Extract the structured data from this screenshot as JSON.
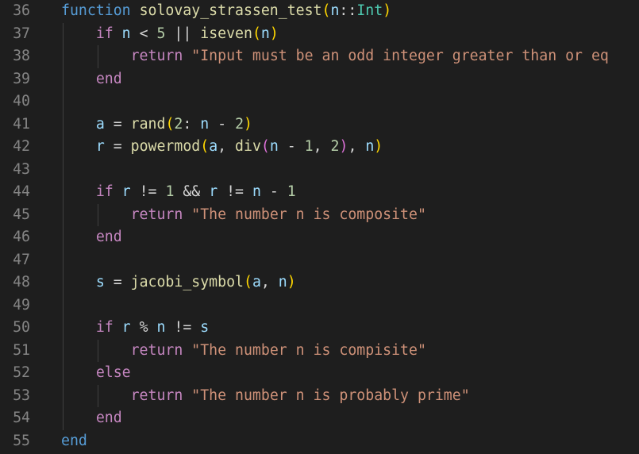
{
  "editor": {
    "theme": {
      "background": "#1e1e1e",
      "line_number": "#858585",
      "keyword": "#569cd6",
      "control": "#c586c0",
      "function": "#dcdcaa",
      "variable": "#9cdcfe",
      "type": "#4ec9b0",
      "number": "#b5cea8",
      "string": "#ce9178",
      "bracket_1": "#ffd700",
      "bracket_2": "#da70d6",
      "bracket_3": "#179fff"
    },
    "lines": [
      {
        "num": "36",
        "tokens": [
          {
            "c": "kw",
            "t": "function"
          },
          {
            "c": "op",
            "t": " "
          },
          {
            "c": "fn",
            "t": "solovay_strassen_test"
          },
          {
            "c": "b1",
            "t": "("
          },
          {
            "c": "var",
            "t": "n"
          },
          {
            "c": "op",
            "t": "::"
          },
          {
            "c": "ty",
            "t": "Int"
          },
          {
            "c": "b1",
            "t": ")"
          }
        ]
      },
      {
        "num": "37",
        "tokens": [
          {
            "c": "op",
            "t": "    "
          },
          {
            "c": "ctl",
            "t": "if"
          },
          {
            "c": "op",
            "t": " "
          },
          {
            "c": "var",
            "t": "n"
          },
          {
            "c": "op",
            "t": " < "
          },
          {
            "c": "num",
            "t": "5"
          },
          {
            "c": "op",
            "t": " || "
          },
          {
            "c": "fn",
            "t": "iseven"
          },
          {
            "c": "b1",
            "t": "("
          },
          {
            "c": "var",
            "t": "n"
          },
          {
            "c": "b1",
            "t": ")"
          }
        ]
      },
      {
        "num": "38",
        "tokens": [
          {
            "c": "op",
            "t": "        "
          },
          {
            "c": "ctl",
            "t": "return"
          },
          {
            "c": "op",
            "t": " "
          },
          {
            "c": "str",
            "t": "\"Input must be an odd integer greater than or eq"
          }
        ]
      },
      {
        "num": "39",
        "tokens": [
          {
            "c": "op",
            "t": "    "
          },
          {
            "c": "ctl",
            "t": "end"
          }
        ]
      },
      {
        "num": "40",
        "tokens": []
      },
      {
        "num": "41",
        "tokens": [
          {
            "c": "op",
            "t": "    "
          },
          {
            "c": "var",
            "t": "a"
          },
          {
            "c": "op",
            "t": " = "
          },
          {
            "c": "fn",
            "t": "rand"
          },
          {
            "c": "b1",
            "t": "("
          },
          {
            "c": "num",
            "t": "2"
          },
          {
            "c": "op",
            "t": ": "
          },
          {
            "c": "var",
            "t": "n"
          },
          {
            "c": "op",
            "t": " - "
          },
          {
            "c": "num",
            "t": "2"
          },
          {
            "c": "b1",
            "t": ")"
          }
        ]
      },
      {
        "num": "42",
        "tokens": [
          {
            "c": "op",
            "t": "    "
          },
          {
            "c": "var",
            "t": "r"
          },
          {
            "c": "op",
            "t": " = "
          },
          {
            "c": "fn",
            "t": "powermod"
          },
          {
            "c": "b1",
            "t": "("
          },
          {
            "c": "var",
            "t": "a"
          },
          {
            "c": "op",
            "t": ", "
          },
          {
            "c": "fn",
            "t": "div"
          },
          {
            "c": "b2",
            "t": "("
          },
          {
            "c": "var",
            "t": "n"
          },
          {
            "c": "op",
            "t": " - "
          },
          {
            "c": "num",
            "t": "1"
          },
          {
            "c": "op",
            "t": ", "
          },
          {
            "c": "num",
            "t": "2"
          },
          {
            "c": "b2",
            "t": ")"
          },
          {
            "c": "op",
            "t": ", "
          },
          {
            "c": "var",
            "t": "n"
          },
          {
            "c": "b1",
            "t": ")"
          }
        ]
      },
      {
        "num": "43",
        "tokens": []
      },
      {
        "num": "44",
        "tokens": [
          {
            "c": "op",
            "t": "    "
          },
          {
            "c": "ctl",
            "t": "if"
          },
          {
            "c": "op",
            "t": " "
          },
          {
            "c": "var",
            "t": "r"
          },
          {
            "c": "op",
            "t": " != "
          },
          {
            "c": "num",
            "t": "1"
          },
          {
            "c": "op",
            "t": " && "
          },
          {
            "c": "var",
            "t": "r"
          },
          {
            "c": "op",
            "t": " != "
          },
          {
            "c": "var",
            "t": "n"
          },
          {
            "c": "op",
            "t": " - "
          },
          {
            "c": "num",
            "t": "1"
          }
        ]
      },
      {
        "num": "45",
        "tokens": [
          {
            "c": "op",
            "t": "        "
          },
          {
            "c": "ctl",
            "t": "return"
          },
          {
            "c": "op",
            "t": " "
          },
          {
            "c": "str",
            "t": "\"The number n is composite\""
          }
        ]
      },
      {
        "num": "46",
        "tokens": [
          {
            "c": "op",
            "t": "    "
          },
          {
            "c": "ctl",
            "t": "end"
          }
        ]
      },
      {
        "num": "47",
        "tokens": []
      },
      {
        "num": "48",
        "tokens": [
          {
            "c": "op",
            "t": "    "
          },
          {
            "c": "var",
            "t": "s"
          },
          {
            "c": "op",
            "t": " = "
          },
          {
            "c": "fn",
            "t": "jacobi_symbol"
          },
          {
            "c": "b1",
            "t": "("
          },
          {
            "c": "var",
            "t": "a"
          },
          {
            "c": "op",
            "t": ", "
          },
          {
            "c": "var",
            "t": "n"
          },
          {
            "c": "b1",
            "t": ")"
          }
        ]
      },
      {
        "num": "49",
        "tokens": []
      },
      {
        "num": "50",
        "tokens": [
          {
            "c": "op",
            "t": "    "
          },
          {
            "c": "ctl",
            "t": "if"
          },
          {
            "c": "op",
            "t": " "
          },
          {
            "c": "var",
            "t": "r"
          },
          {
            "c": "op",
            "t": " % "
          },
          {
            "c": "var",
            "t": "n"
          },
          {
            "c": "op",
            "t": " != "
          },
          {
            "c": "var",
            "t": "s"
          }
        ]
      },
      {
        "num": "51",
        "tokens": [
          {
            "c": "op",
            "t": "        "
          },
          {
            "c": "ctl",
            "t": "return"
          },
          {
            "c": "op",
            "t": " "
          },
          {
            "c": "str",
            "t": "\"The number n is compisite\""
          }
        ]
      },
      {
        "num": "52",
        "tokens": [
          {
            "c": "op",
            "t": "    "
          },
          {
            "c": "ctl",
            "t": "else"
          }
        ]
      },
      {
        "num": "53",
        "tokens": [
          {
            "c": "op",
            "t": "        "
          },
          {
            "c": "ctl",
            "t": "return"
          },
          {
            "c": "op",
            "t": " "
          },
          {
            "c": "str",
            "t": "\"The number n is probably prime\""
          }
        ]
      },
      {
        "num": "54",
        "tokens": [
          {
            "c": "op",
            "t": "    "
          },
          {
            "c": "ctl",
            "t": "end"
          }
        ]
      },
      {
        "num": "55",
        "tokens": [
          {
            "c": "kw",
            "t": "end"
          }
        ]
      }
    ]
  }
}
